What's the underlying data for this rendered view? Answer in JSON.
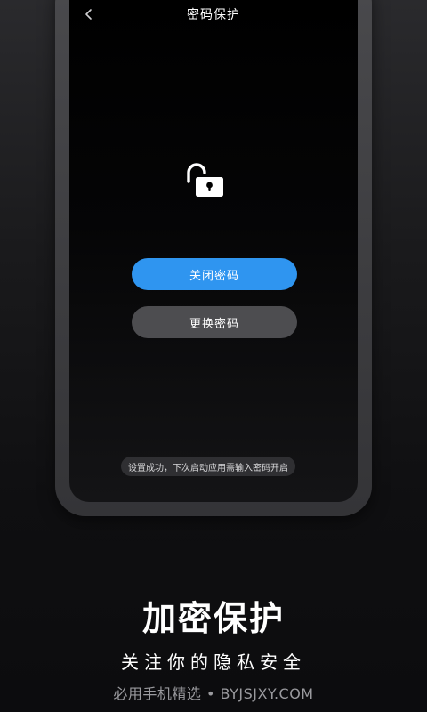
{
  "screen": {
    "title": "密码保护",
    "back_icon": "chevron-left-icon",
    "lock_icon": "unlocked-padlock-icon",
    "buttons": {
      "close_password": "关闭密码",
      "change_password": "更换密码"
    },
    "toast": "设置成功，下次启动应用需输入密码开启"
  },
  "promo": {
    "headline": "加密保护",
    "subline": "关注你的隐私安全",
    "watermark": "必用手机精选 • BYJSJXY.COM"
  },
  "colors": {
    "primary_button": "#2f95f0",
    "secondary_button": "#4d4d50",
    "background": "#0d0d0f"
  }
}
